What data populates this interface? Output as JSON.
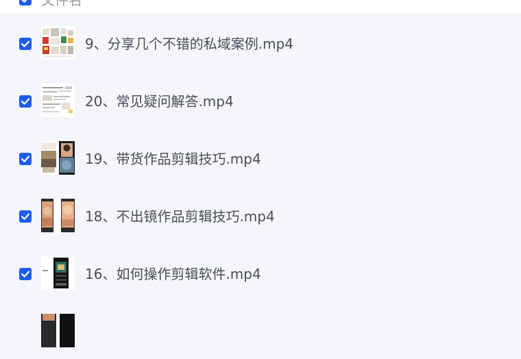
{
  "header": {
    "label": "文件名",
    "checked": true
  },
  "files": [
    {
      "name": "9、分享几个不错的私域案例.mp4",
      "checked": true,
      "thumb_icon": "video-thumbnail-icon"
    },
    {
      "name": "20、常见疑问解答.mp4",
      "checked": true,
      "thumb_icon": "video-thumbnail-icon"
    },
    {
      "name": "19、带货作品剪辑技巧.mp4",
      "checked": true,
      "thumb_icon": "video-thumbnail-icon"
    },
    {
      "name": "18、不出镜作品剪辑技巧.mp4",
      "checked": true,
      "thumb_icon": "video-thumbnail-icon"
    },
    {
      "name": "16、如何操作剪辑软件.mp4",
      "checked": true,
      "thumb_icon": "video-thumbnail-icon"
    }
  ],
  "colors": {
    "checkbox": "#1f5bef",
    "row_bg": "#f5f6fc",
    "text": "#4a4d55"
  }
}
